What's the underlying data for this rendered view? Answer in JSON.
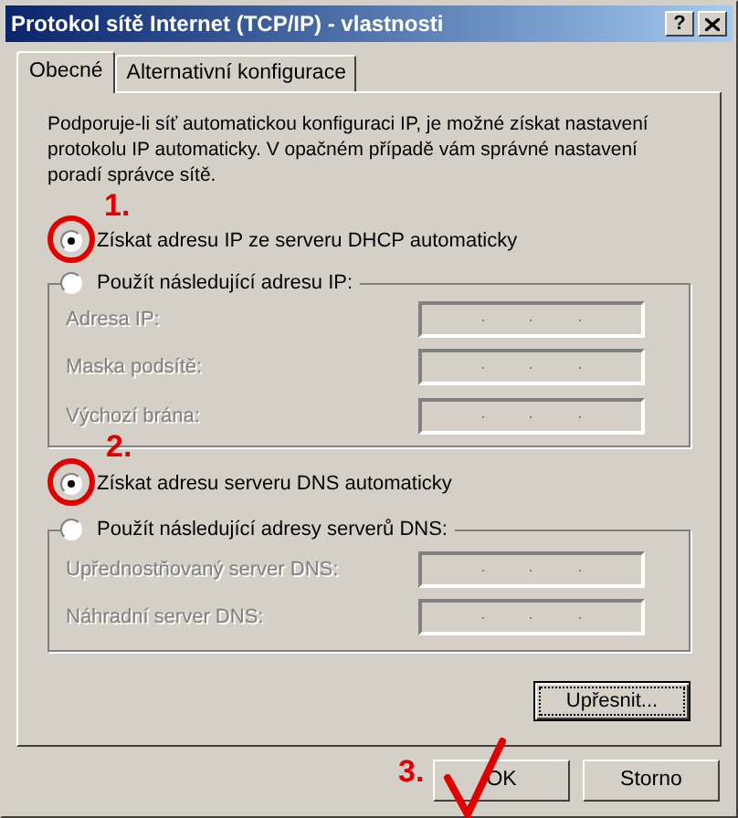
{
  "window": {
    "title": "Protokol sítě Internet (TCP/IP) - vlastnosti",
    "help_button": "?"
  },
  "tabs": [
    {
      "label": "Obecné",
      "selected": true
    },
    {
      "label": "Alternativní konfigurace",
      "selected": false
    }
  ],
  "description": "Podporuje-li síť automatickou konfiguraci IP, je možné získat nastavení protokolu IP automaticky. V opačném případě vám správné nastavení poradí správce sítě.",
  "ip": {
    "options": [
      {
        "label": "Získat adresu IP ze serveru DHCP automaticky",
        "selected": true
      },
      {
        "label": "Použít následující adresu IP:",
        "selected": false
      }
    ],
    "fields": [
      {
        "label": "Adresa IP:",
        "disabled": true
      },
      {
        "label": "Maska podsítě:",
        "disabled": true
      },
      {
        "label": "Výchozí brána:",
        "disabled": true
      }
    ]
  },
  "dns": {
    "options": [
      {
        "label": "Získat adresu serveru DNS automaticky",
        "selected": true
      },
      {
        "label": "Použít následující adresy serverů DNS:",
        "selected": false
      }
    ],
    "fields": [
      {
        "label": "Upřednostňovaný server DNS:",
        "disabled": true
      },
      {
        "label": "Náhradní server DNS:",
        "disabled": true
      }
    ]
  },
  "advanced_button": "Upřesnit...",
  "buttons": [
    "OK",
    "Storno"
  ],
  "annotations": [
    {
      "text": "1."
    },
    {
      "text": "2."
    },
    {
      "text": "3."
    }
  ]
}
